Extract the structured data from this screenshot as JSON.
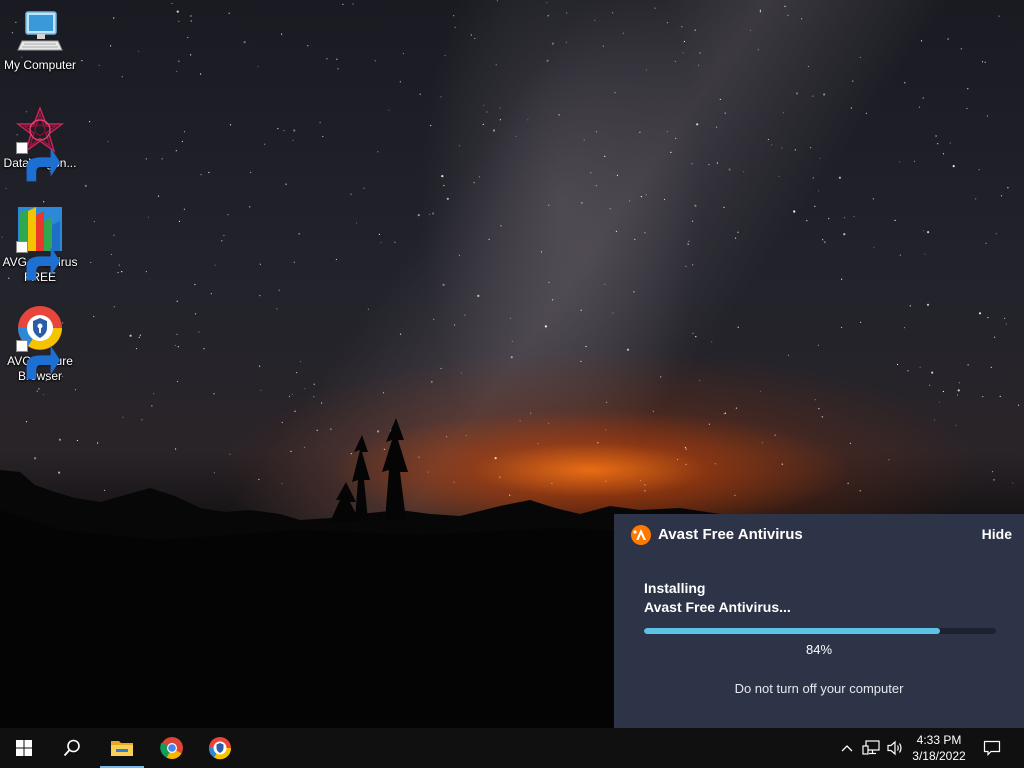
{
  "desktop": {
    "icons": [
      {
        "label": "My Computer",
        "icon": "computer-icon",
        "shortcut": false
      },
      {
        "label": "DataWagon...",
        "icon": "datawagon-icon",
        "shortcut": true
      },
      {
        "label": "AVG AntiVirus FREE",
        "icon": "avg-antivirus-icon",
        "shortcut": true
      },
      {
        "label": "AVG Secure Browser",
        "icon": "avg-secure-browser-icon",
        "shortcut": true
      }
    ]
  },
  "notification": {
    "app_name": "Avast Free Antivirus",
    "hide_label": "Hide",
    "status_line1": "Installing",
    "status_line2": "Avast Free Antivirus...",
    "progress_value": 84,
    "progress_text": "84%",
    "warning": "Do not turn off your computer",
    "colors": {
      "background": "#2d3447",
      "progress": "#5cc3e6",
      "logo": "#ff7800"
    }
  },
  "taskbar": {
    "start_icon": "windows-start-icon",
    "search_icon": "search-icon",
    "pinned": [
      {
        "name": "file-explorer",
        "icon": "folder-icon",
        "active": true
      },
      {
        "name": "google-chrome",
        "icon": "chrome-icon",
        "active": false
      },
      {
        "name": "avg-secure-browser",
        "icon": "avg-secure-browser-icon",
        "active": false
      }
    ],
    "tray_icons": [
      "chevron-up-icon",
      "network-icon",
      "volume-icon"
    ],
    "clock": {
      "time": "4:33 PM",
      "date": "3/18/2022"
    },
    "action_center_icon": "notification-center-icon"
  }
}
